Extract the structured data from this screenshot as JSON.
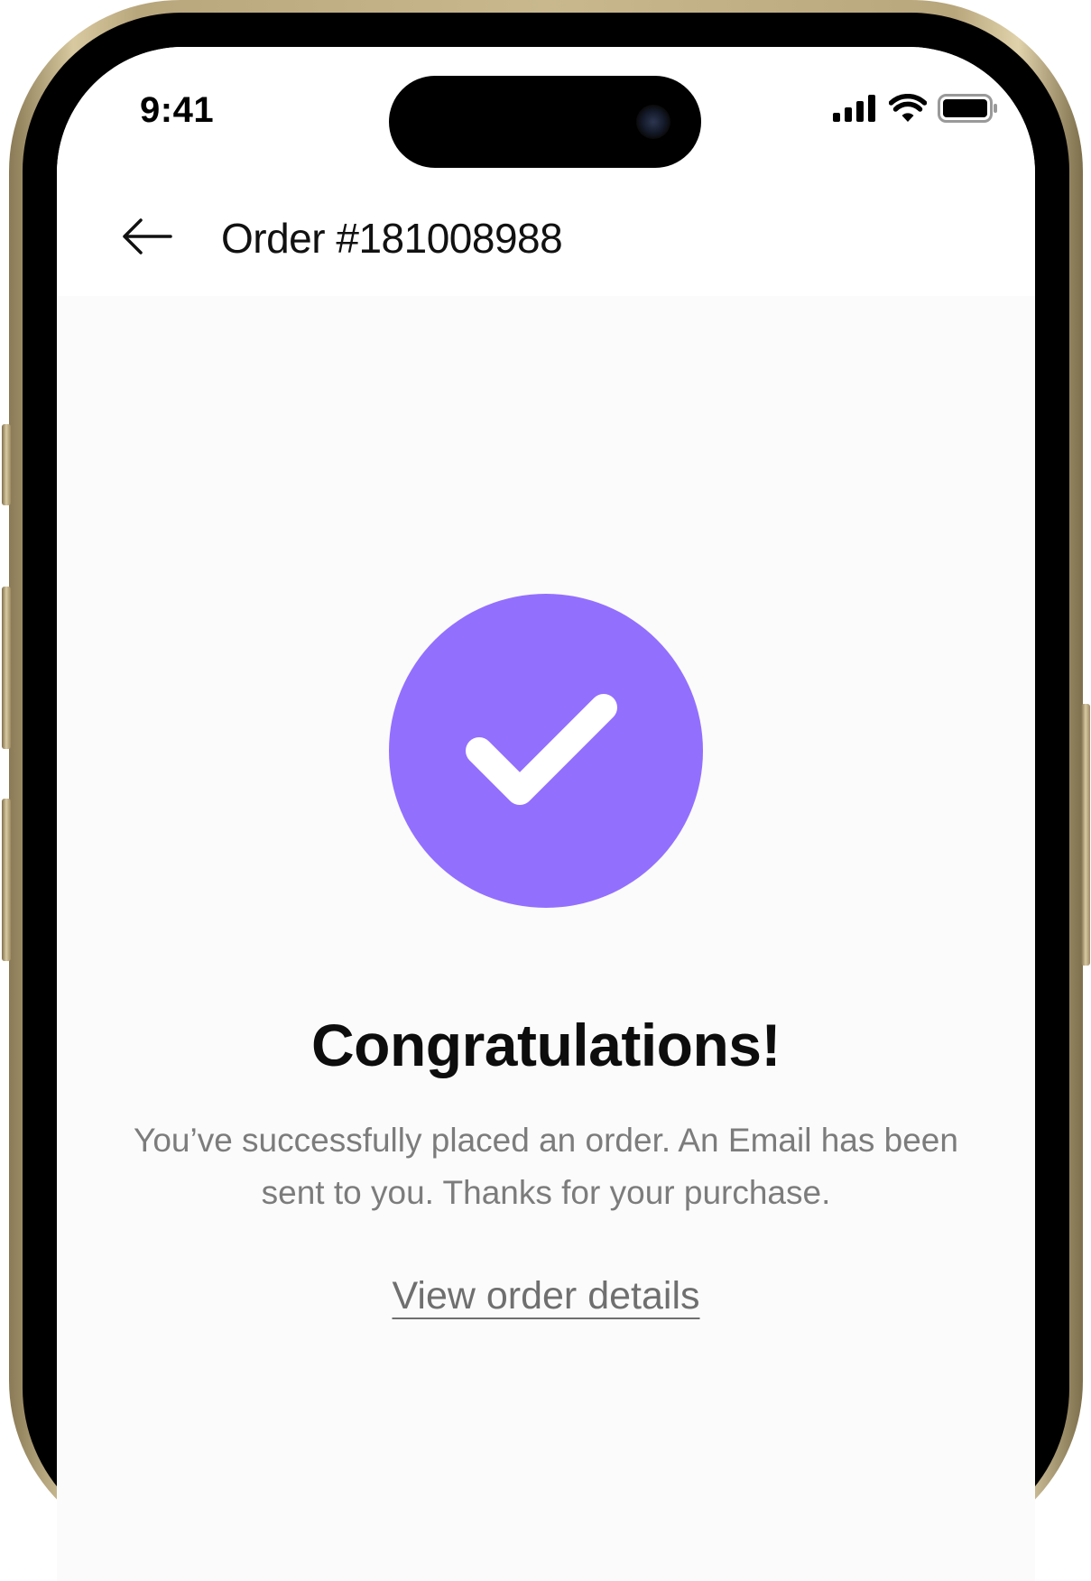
{
  "status_bar": {
    "time": "9:41"
  },
  "header": {
    "back_icon": "arrow-left-icon",
    "title": "Order #181008988"
  },
  "success": {
    "icon": "checkmark-icon",
    "accent_color": "#936ffe",
    "heading": "Congratulations!",
    "message": "You’ve successfully placed an order. An Email has been sent to you. Thanks for your purchase.",
    "link_label": "View order details"
  }
}
